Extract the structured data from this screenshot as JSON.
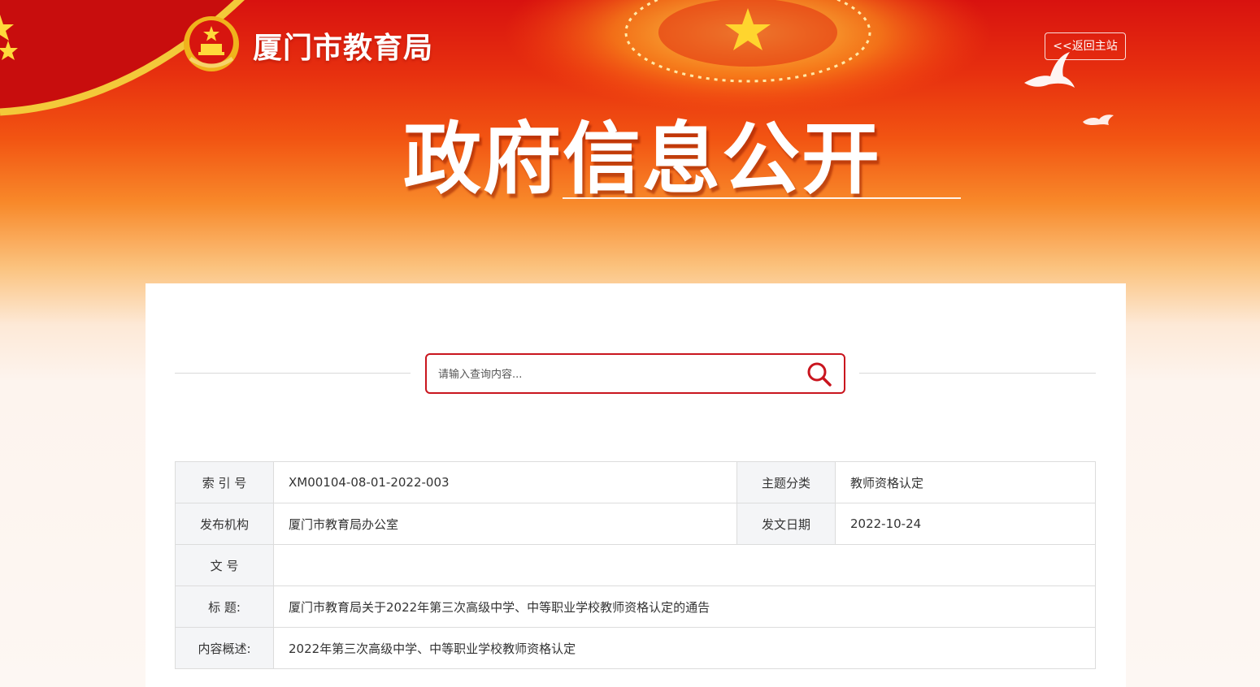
{
  "header": {
    "site_name": "厦门市教育局",
    "back_label": "<<返回主站",
    "headline": "政府信息公开"
  },
  "search": {
    "placeholder": "请输入查询内容..."
  },
  "info": {
    "index_label": "索 引 号",
    "index_value": "XM00104-08-01-2022-003",
    "topic_label": "主题分类",
    "topic_value": "教师资格认定",
    "publisher_label": "发布机构",
    "publisher_value": "厦门市教育局办公室",
    "date_label": "发文日期",
    "date_value": "2022-10-24",
    "docno_label": "文 号",
    "docno_value": "",
    "title_label": "标 题:",
    "title_value": "厦门市教育局关于2022年第三次高级中学、中等职业学校教师资格认定的通告",
    "summary_label": "内容概述:",
    "summary_value": "2022年第三次高级中学、中等职业学校教师资格认定"
  },
  "icons": {
    "logo": "national-emblem-icon",
    "search": "search-icon",
    "dove": "dove-icon"
  },
  "colors": {
    "accent": "#c9151e",
    "banner_red": "#d8120f"
  }
}
